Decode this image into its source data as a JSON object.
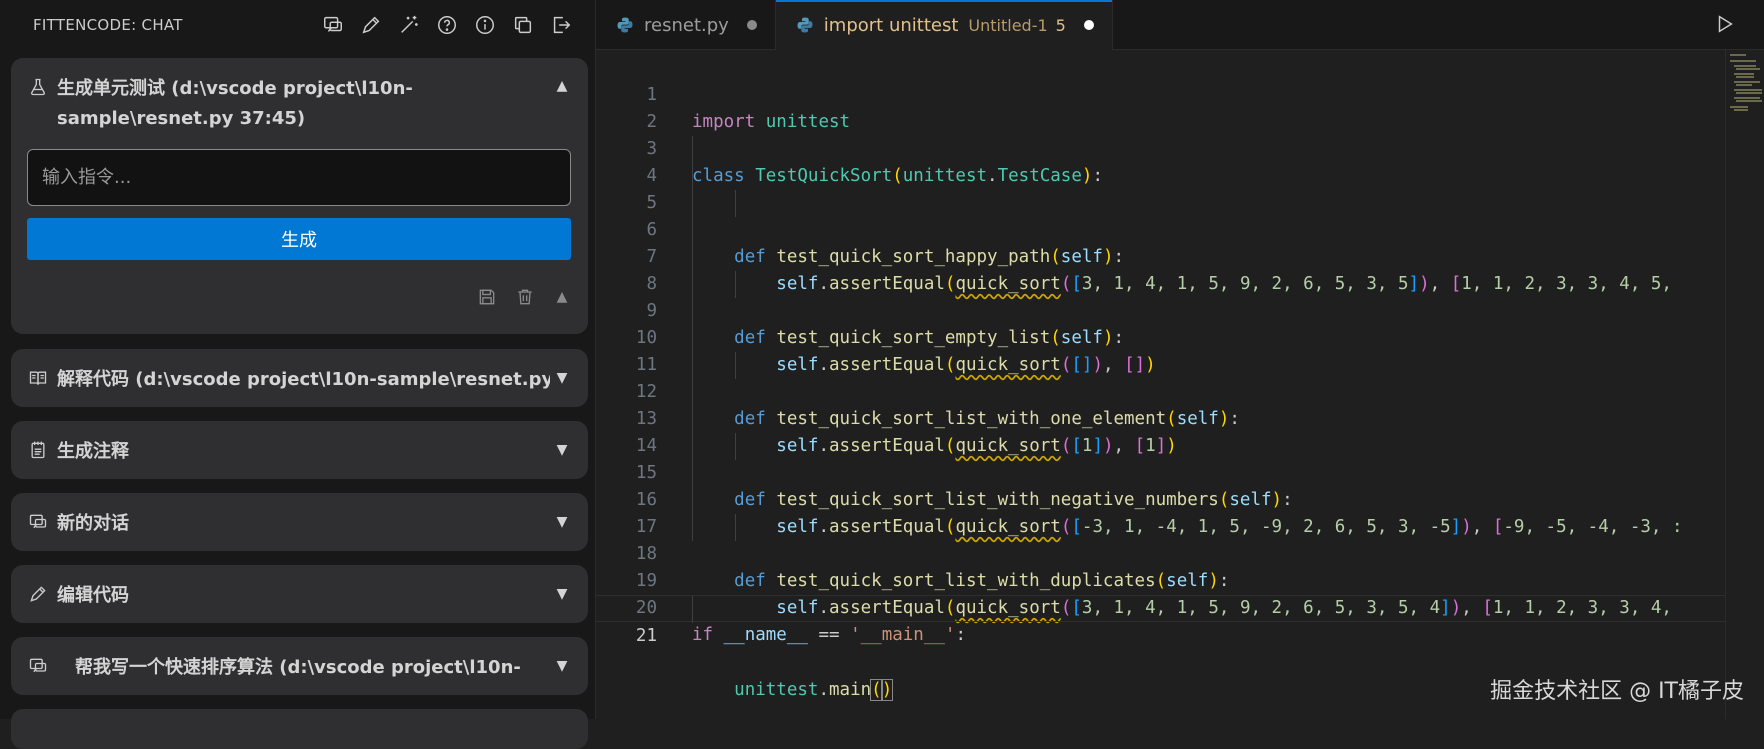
{
  "sidebar": {
    "title": "FITTENCODE: CHAT",
    "actions": [
      "new-chat-icon",
      "pencil-icon",
      "magic-wand-icon",
      "help-icon",
      "info-icon",
      "copy-icon",
      "exit-icon"
    ],
    "panel_unit_test": {
      "title": "生成单元测试 (d:\\vscode project\\l10n-sample\\resnet.py 37:45)",
      "input_placeholder": "输入指令...",
      "generate_label": "生成"
    },
    "panels": [
      {
        "title": "解释代码 (d:\\vscode project\\l10n-sample\\resnet.py"
      },
      {
        "title": "生成注释"
      },
      {
        "title": "新的对话"
      },
      {
        "title": "编辑代码"
      },
      {
        "title": "帮我写一个快速排序算法 (d:\\vscode project\\l10n-"
      }
    ]
  },
  "tabs": [
    {
      "name": "resnet.py"
    },
    {
      "name": "import unittest",
      "sub": "Untitled-1",
      "count": "5"
    }
  ],
  "code_lines": [
    {
      "n": "1"
    },
    {
      "n": "2"
    },
    {
      "n": "3"
    },
    {
      "n": "4"
    },
    {
      "n": "5"
    },
    {
      "n": "6"
    },
    {
      "n": "7"
    },
    {
      "n": "8"
    },
    {
      "n": "9"
    },
    {
      "n": "10"
    },
    {
      "n": "11"
    },
    {
      "n": "12"
    },
    {
      "n": "13"
    },
    {
      "n": "14"
    },
    {
      "n": "15"
    },
    {
      "n": "16"
    },
    {
      "n": "17"
    },
    {
      "n": "18"
    },
    {
      "n": "19"
    },
    {
      "n": "20"
    },
    {
      "n": "21"
    }
  ],
  "code": {
    "l1": [
      "import",
      "unittest"
    ],
    "l3": [
      "class",
      "TestQuickSort",
      "unittest",
      "TestCase"
    ],
    "l5": [
      "def",
      "test_quick_sort_happy_path",
      "self"
    ],
    "l6": [
      "self",
      "assertEqual",
      "quick_sort",
      "3, 1, 4, 1, 5, 9, 2, 6, 5, 3, 5",
      "1, 1, 2, 3, 3, 4, 5,"
    ],
    "l8": [
      "def",
      "test_quick_sort_empty_list",
      "self"
    ],
    "l9": [
      "self",
      "assertEqual",
      "quick_sort"
    ],
    "l11": [
      "def",
      "test_quick_sort_list_with_one_element",
      "self"
    ],
    "l12": [
      "self",
      "assertEqual",
      "quick_sort",
      "1",
      "1"
    ],
    "l14": [
      "def",
      "test_quick_sort_list_with_negative_numbers",
      "self"
    ],
    "l15": [
      "self",
      "assertEqual",
      "quick_sort",
      "-3, 1, -4, 1, 5, -9, 2, 6, 5, 3, -5",
      "-9, -5, -4, -3, :"
    ],
    "l17": [
      "def",
      "test_quick_sort_list_with_duplicates",
      "self"
    ],
    "l18": [
      "self",
      "assertEqual",
      "quick_sort",
      "3, 1, 4, 1, 5, 9, 2, 6, 5, 3, 5, 4",
      "1, 1, 2, 3, 3, 4,"
    ],
    "l20": [
      "if",
      "__name__",
      "==",
      "'__main__'"
    ],
    "l21": [
      "unittest",
      "main"
    ]
  },
  "watermark": "掘金技术社区 @ IT橘子皮"
}
